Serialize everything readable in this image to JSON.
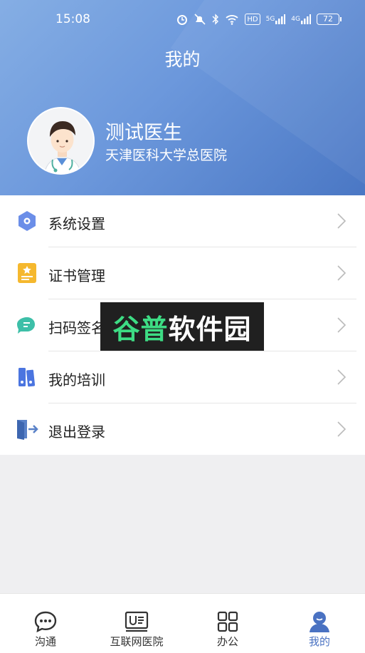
{
  "status_bar": {
    "time": "15:08",
    "battery": "72",
    "network_5g": "5G",
    "network_4g": "4G",
    "hd": "HD"
  },
  "header": {
    "title": "我的"
  },
  "profile": {
    "name": "测试医生",
    "hospital": "天津医科大学总医院"
  },
  "menu": {
    "items": [
      {
        "label": "系统设置",
        "icon": "gear-hexagon-icon"
      },
      {
        "label": "证书管理",
        "icon": "certificate-icon"
      },
      {
        "label": "扫码签名",
        "icon": "scan-sign-icon"
      },
      {
        "label": "我的培训",
        "icon": "training-books-icon"
      },
      {
        "label": "退出登录",
        "icon": "logout-door-icon"
      }
    ]
  },
  "watermark": {
    "part1": "谷普",
    "part2": "软件园"
  },
  "tabbar": {
    "items": [
      {
        "label": "沟通",
        "icon": "chat-bubble-icon"
      },
      {
        "label": "互联网医院",
        "icon": "clinic-board-icon"
      },
      {
        "label": "办公",
        "icon": "grid-apps-icon"
      },
      {
        "label": "我的",
        "icon": "user-icon"
      }
    ],
    "active_index": 3
  },
  "colors": {
    "accent": "#4a72c2",
    "header_start": "#85aee4",
    "header_end": "#4a77c4"
  }
}
